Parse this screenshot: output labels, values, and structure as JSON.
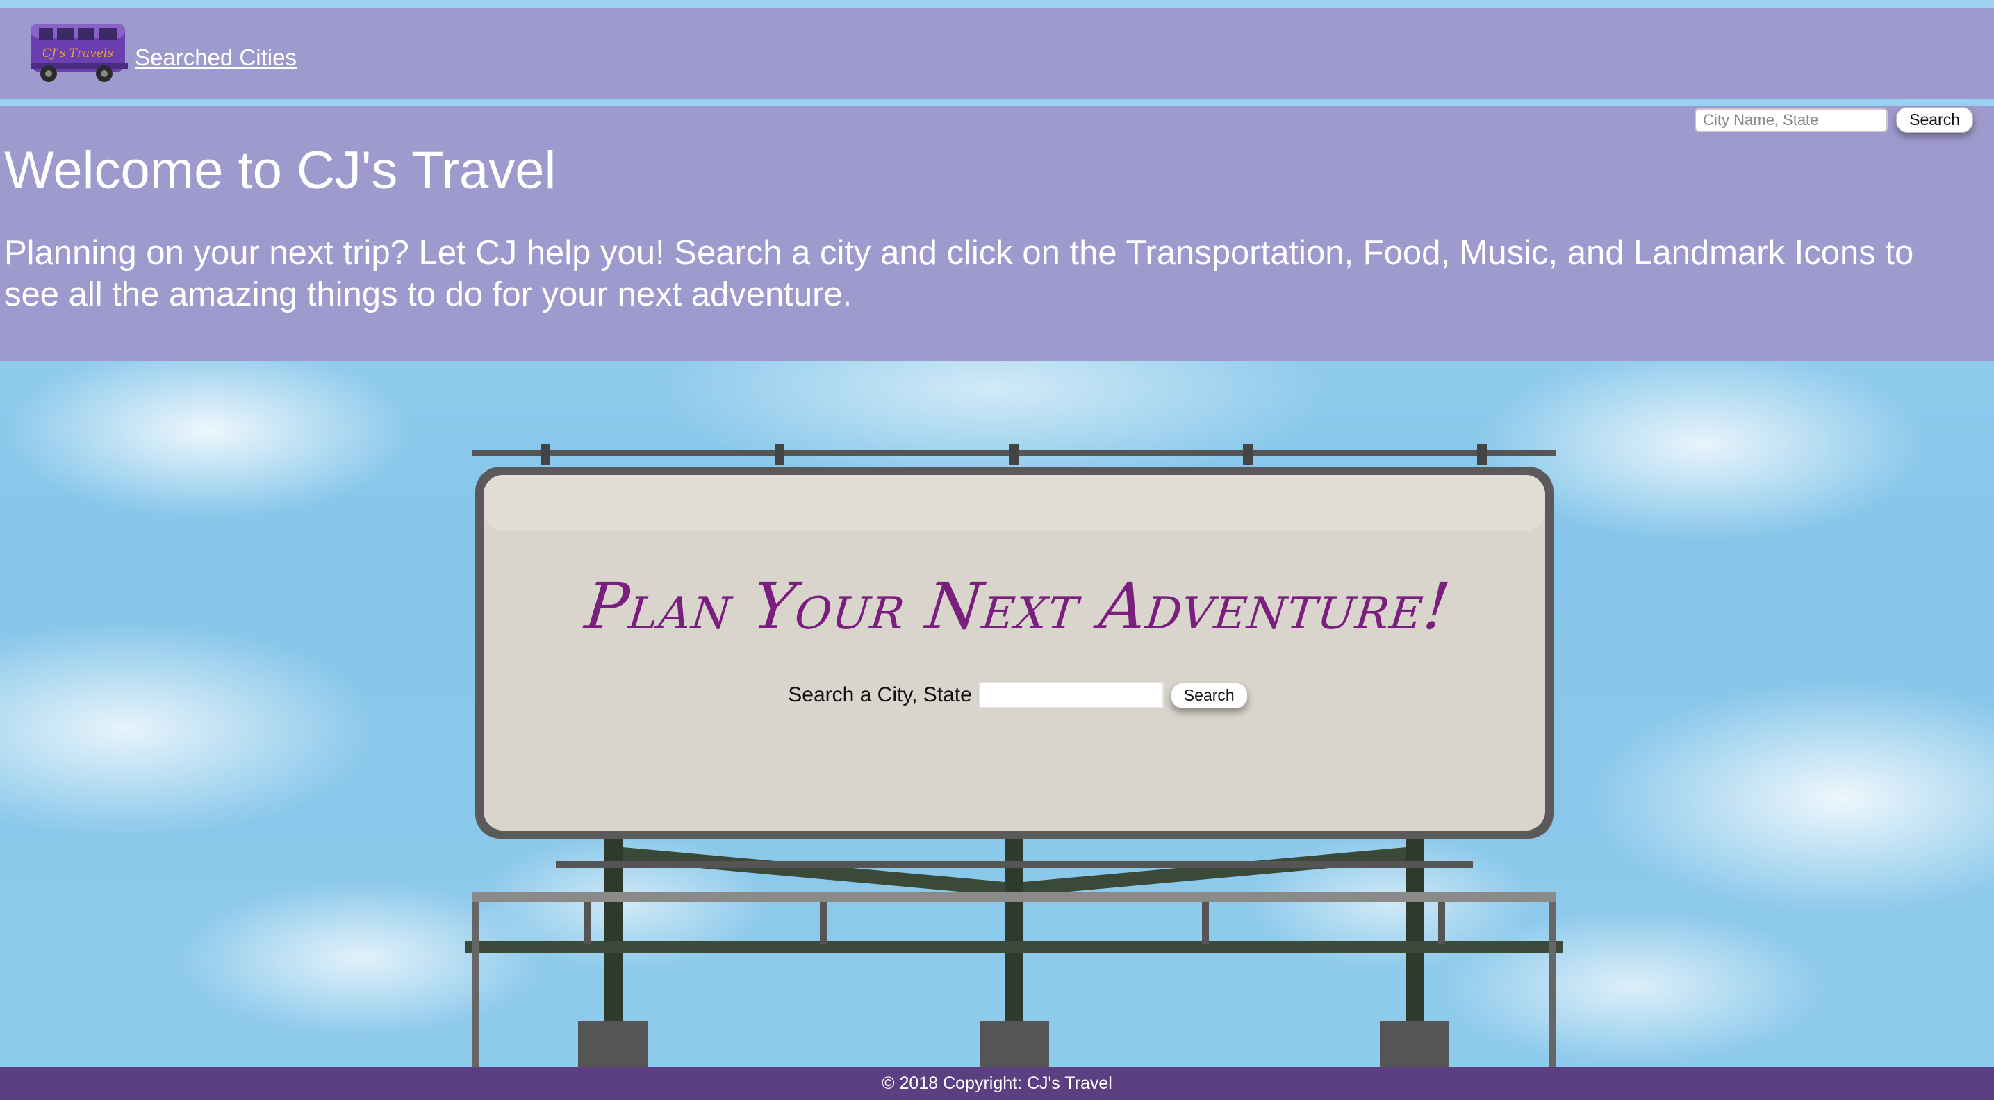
{
  "navbar": {
    "logo_text": "CJ's Travels",
    "link_label": "Searched Cities"
  },
  "top_search": {
    "placeholder": "City Name, State",
    "button_label": "Search"
  },
  "jumbotron": {
    "title": "Welcome to CJ's Travel",
    "text": "Planning on your next trip? Let CJ help you! Search a city and click on the Transportation, Food, Music, and Landmark Icons to see all the amazing things to do for your next adventure."
  },
  "billboard": {
    "headline": "Plan Your Next Adventure!",
    "search_label": "Search a City, State",
    "search_value": "",
    "button_label": "Search"
  },
  "footer": {
    "copyright": "© 2018 Copyright: CJ's Travel"
  },
  "colors": {
    "nav_bg": "#9f9acd",
    "footer_bg": "#5b3f80",
    "headline": "#7a1f7e",
    "sky": "#8ec9ea"
  },
  "icons": {
    "logo": "van-logo-icon"
  }
}
